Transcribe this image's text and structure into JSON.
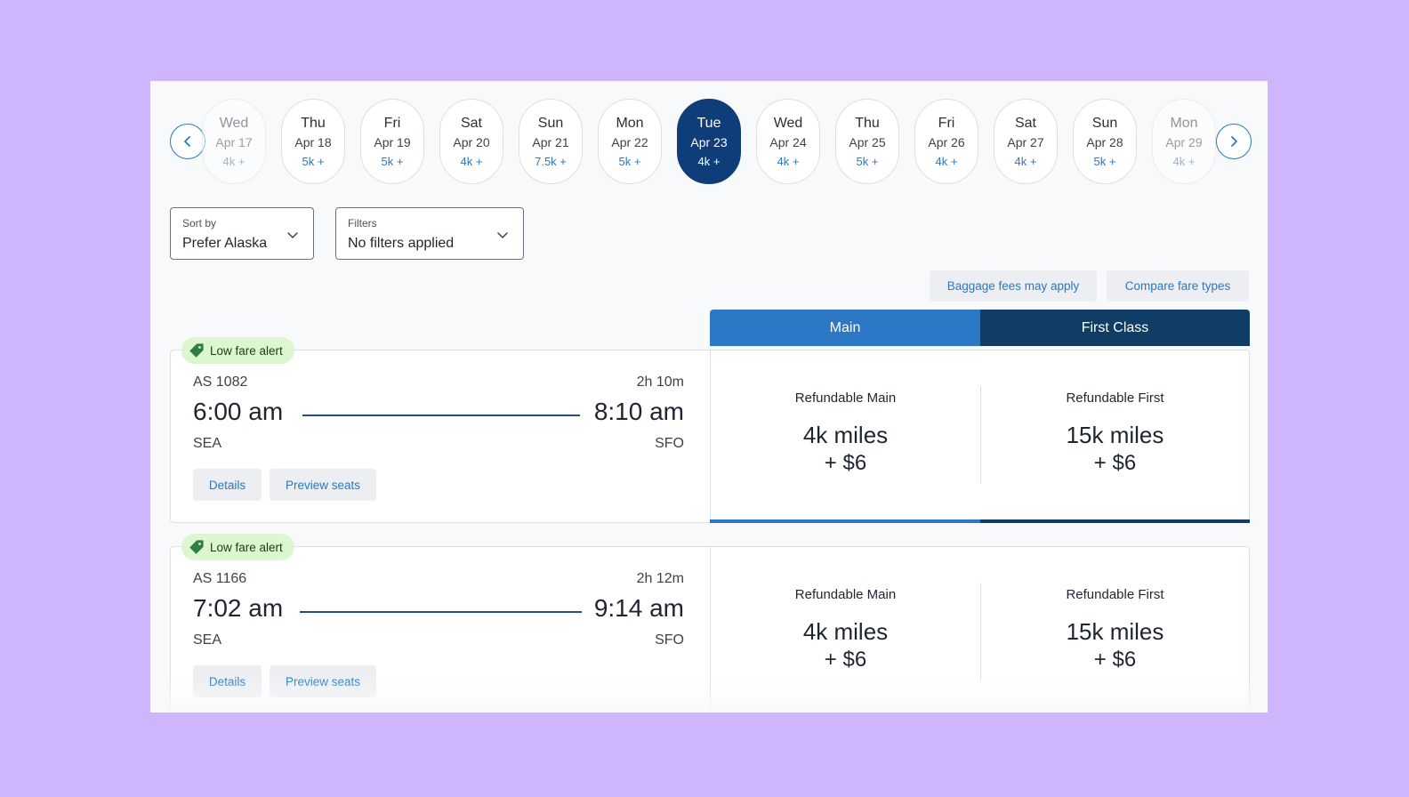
{
  "date_strip": {
    "days": [
      {
        "dow": "Wed",
        "date": "Apr 17",
        "price": "4k +"
      },
      {
        "dow": "Thu",
        "date": "Apr 18",
        "price": "5k +"
      },
      {
        "dow": "Fri",
        "date": "Apr 19",
        "price": "5k +"
      },
      {
        "dow": "Sat",
        "date": "Apr 20",
        "price": "4k +"
      },
      {
        "dow": "Sun",
        "date": "Apr 21",
        "price": "7.5k +"
      },
      {
        "dow": "Mon",
        "date": "Apr 22",
        "price": "5k +"
      },
      {
        "dow": "Tue",
        "date": "Apr 23",
        "price": "4k +"
      },
      {
        "dow": "Wed",
        "date": "Apr 24",
        "price": "4k +"
      },
      {
        "dow": "Thu",
        "date": "Apr 25",
        "price": "5k +"
      },
      {
        "dow": "Fri",
        "date": "Apr 26",
        "price": "4k +"
      },
      {
        "dow": "Sat",
        "date": "Apr 27",
        "price": "4k +"
      },
      {
        "dow": "Sun",
        "date": "Apr 28",
        "price": "5k +"
      },
      {
        "dow": "Mon",
        "date": "Apr 29",
        "price": "4k +"
      }
    ],
    "selected": "Apr 23"
  },
  "sort": {
    "label": "Sort by",
    "value": "Prefer Alaska"
  },
  "filters": {
    "label": "Filters",
    "value": "No filters applied"
  },
  "actions": {
    "baggage": "Baggage fees may apply",
    "compare": "Compare fare types"
  },
  "fare_headers": {
    "main": "Main",
    "first": "First Class"
  },
  "flights": [
    {
      "badge": "Low fare alert",
      "number": "AS 1082",
      "duration": "2h 10m",
      "depart": "6:00 am",
      "arrive": "8:10 am",
      "from": "SEA",
      "to": "SFO",
      "details": "Details",
      "preview": "Preview seats",
      "main_fare": {
        "name": "Refundable Main",
        "miles": "4k miles",
        "tax": "+ $6"
      },
      "first_fare": {
        "name": "Refundable First",
        "miles": "15k miles",
        "tax": "+ $6"
      }
    },
    {
      "badge": "Low fare alert",
      "number": "AS 1166",
      "duration": "2h 12m",
      "depart": "7:02 am",
      "arrive": "9:14 am",
      "from": "SEA",
      "to": "SFO",
      "details": "Details",
      "preview": "Preview seats",
      "main_fare": {
        "name": "Refundable Main",
        "miles": "4k miles",
        "tax": "+ $6"
      },
      "first_fare": {
        "name": "Refundable First",
        "miles": "15k miles",
        "tax": "+ $6"
      }
    }
  ],
  "icons": {
    "prev": "chevron-left-icon",
    "next": "chevron-right-icon",
    "tag": "price-tag-icon",
    "dropdown": "chevron-down-icon"
  },
  "colors": {
    "accent": "#2d78c6",
    "navy": "#0f3d7a",
    "first_class": "#0f3d66",
    "badge_bg": "#dcf6cf",
    "background": "#cfb5fb"
  }
}
